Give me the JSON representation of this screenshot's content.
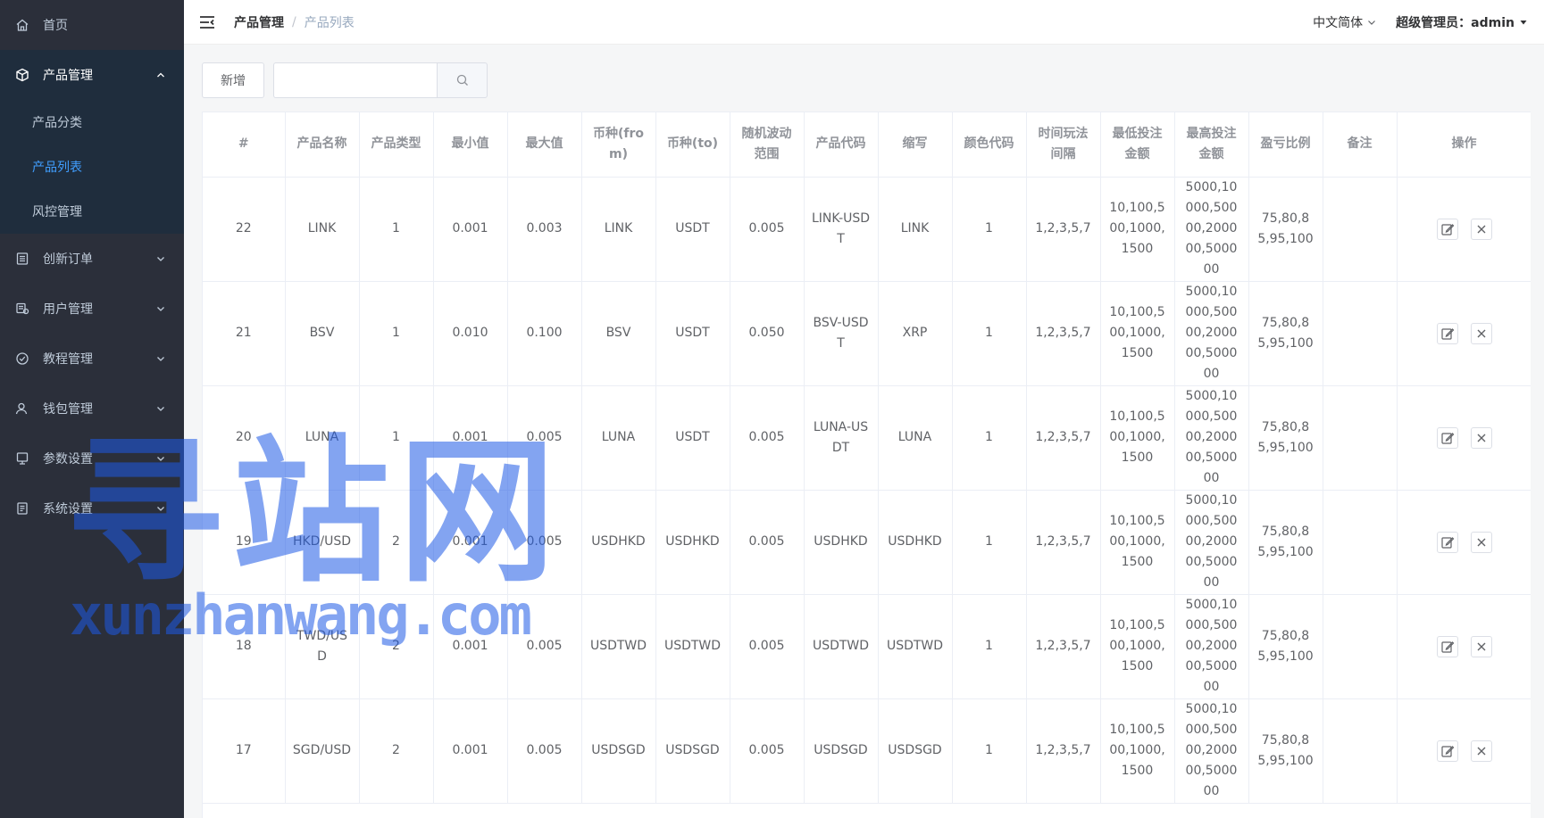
{
  "colors": {
    "sidebar_bg": "#2b2f3a",
    "submenu_bg": "#1f2d3d",
    "active": "#409eff",
    "watermark": "#1e5ae6"
  },
  "sidebar": {
    "home": {
      "label": "首页",
      "icon": "home-icon"
    },
    "product": {
      "label": "产品管理",
      "icon": "cube-icon",
      "children": [
        {
          "label": "产品分类"
        },
        {
          "label": "产品列表"
        },
        {
          "label": "风控管理"
        }
      ]
    },
    "items": [
      {
        "label": "创新订单",
        "icon": "list-icon"
      },
      {
        "label": "用户管理",
        "icon": "users-icon"
      },
      {
        "label": "教程管理",
        "icon": "check-circle-icon"
      },
      {
        "label": "钱包管理",
        "icon": "user-icon"
      },
      {
        "label": "参数设置",
        "icon": "monitor-icon"
      },
      {
        "label": "系统设置",
        "icon": "document-icon"
      }
    ]
  },
  "header": {
    "breadcrumb": [
      "产品管理",
      "产品列表"
    ],
    "breadcrumb_sep": "/",
    "language": "中文简体",
    "user": "超级管理员：admin"
  },
  "toolbar": {
    "add_label": "新增",
    "search_value": ""
  },
  "table": {
    "headers": [
      "#",
      "产品名称",
      "产品类型",
      "最小值",
      "最大值",
      "币种(from)",
      "币种(to)",
      "随机波动范围",
      "产品代码",
      "缩写",
      "颜色代码",
      "时间玩法间隔",
      "最低投注金额",
      "最高投注金额",
      "盈亏比例",
      "备注",
      "操作"
    ],
    "rows": [
      [
        "22",
        "LINK",
        "1",
        "0.001",
        "0.003",
        "LINK",
        "USDT",
        "0.005",
        "LINK-USDT",
        "LINK",
        "1",
        "1,2,3,5,7",
        "10,100,500,1000,1500",
        "5000,10000,50000,200000,500000",
        "75,80,85,95,100",
        ""
      ],
      [
        "21",
        "BSV",
        "1",
        "0.010",
        "0.100",
        "BSV",
        "USDT",
        "0.050",
        "BSV-USDT",
        "XRP",
        "1",
        "1,2,3,5,7",
        "10,100,500,1000,1500",
        "5000,10000,50000,200000,500000",
        "75,80,85,95,100",
        ""
      ],
      [
        "20",
        "LUNA",
        "1",
        "0.001",
        "0.005",
        "LUNA",
        "USDT",
        "0.005",
        "LUNA-USDT",
        "LUNA",
        "1",
        "1,2,3,5,7",
        "10,100,500,1000,1500",
        "5000,10000,50000,200000,500000",
        "75,80,85,95,100",
        ""
      ],
      [
        "19",
        "HKD/USD",
        "2",
        "0.001",
        "0.005",
        "USDHKD",
        "USDHKD",
        "0.005",
        "USDHKD",
        "USDHKD",
        "1",
        "1,2,3,5,7",
        "10,100,500,1000,1500",
        "5000,10000,50000,200000,500000",
        "75,80,85,95,100",
        ""
      ],
      [
        "18",
        "TWD/USD",
        "2",
        "0.001",
        "0.005",
        "USDTWD",
        "USDTWD",
        "0.005",
        "USDTWD",
        "USDTWD",
        "1",
        "1,2,3,5,7",
        "10,100,500,1000,1500",
        "5000,10000,50000,200000,500000",
        "75,80,85,95,100",
        ""
      ],
      [
        "17",
        "SGD/USD",
        "2",
        "0.001",
        "0.005",
        "USDSGD",
        "USDSGD",
        "0.005",
        "USDSGD",
        "USDSGD",
        "1",
        "1,2,3,5,7",
        "10,100,500,1000,1500",
        "5000,10000,50000,200000,500000",
        "75,80,85,95,100",
        ""
      ]
    ]
  },
  "watermark": {
    "cn": "寻站网",
    "en": "xunzhanwang.com"
  }
}
